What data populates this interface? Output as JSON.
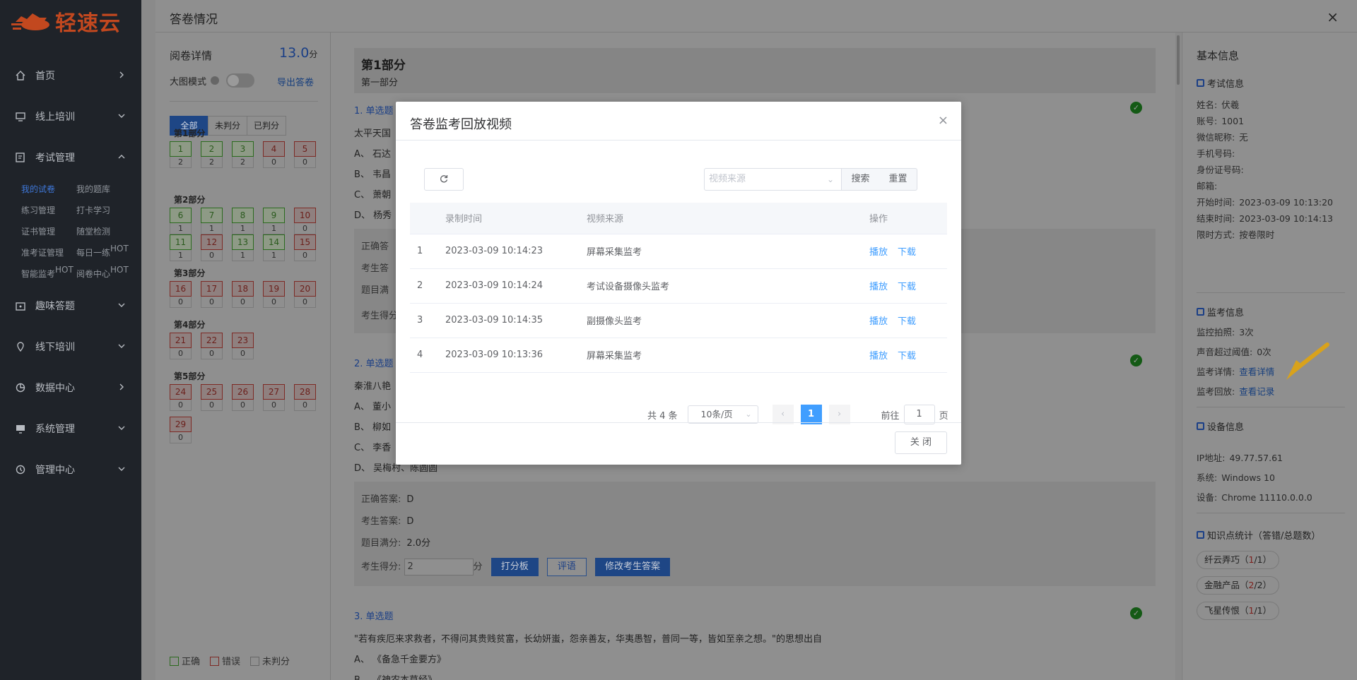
{
  "app": {
    "brand": "轻速云"
  },
  "sidebar": {
    "items": [
      {
        "label": "首页",
        "icon": "home-icon"
      },
      {
        "label": "线上培训",
        "icon": "monitor-icon"
      },
      {
        "label": "考试管理",
        "icon": "exam-icon"
      },
      {
        "label": "趣味答题",
        "icon": "quiz-icon"
      },
      {
        "label": "线下培训",
        "icon": "location-icon"
      },
      {
        "label": "数据中心",
        "icon": "chart-icon"
      },
      {
        "label": "系统管理",
        "icon": "desktop-icon"
      },
      {
        "label": "管理中心",
        "icon": "history-icon"
      }
    ],
    "sub": [
      "我的试卷",
      "我的题库",
      "练习管理",
      "打卡学习",
      "证书管理",
      "随堂检测",
      "准考证管理",
      "每日一练",
      "智能监考",
      "阅卷中心"
    ],
    "hot": "HOT"
  },
  "topbar": {
    "title": "答卷情况",
    "close": "×"
  },
  "left": {
    "title": "阅卷详情",
    "score": "13.0",
    "score_unit": "分",
    "big_mode": "大图模式",
    "export": "导出答卷",
    "filters": [
      "全部",
      "未判分",
      "已判分"
    ],
    "parts": [
      {
        "name": "第1部分",
        "q": [
          [
            "1",
            "2",
            "g"
          ],
          [
            "2",
            "2",
            "g"
          ],
          [
            "3",
            "2",
            "g"
          ],
          [
            "4",
            "0",
            "r"
          ],
          [
            "5",
            "0",
            "r"
          ]
        ]
      },
      {
        "name": "第2部分",
        "q": [
          [
            "6",
            "1",
            "g"
          ],
          [
            "7",
            "1",
            "g"
          ],
          [
            "8",
            "1",
            "g"
          ],
          [
            "9",
            "1",
            "g"
          ],
          [
            "10",
            "0",
            "r"
          ]
        ]
      },
      {
        "name": "",
        "q": [
          [
            "11",
            "1",
            "g"
          ],
          [
            "12",
            "0",
            "r"
          ],
          [
            "13",
            "1",
            "g"
          ],
          [
            "14",
            "1",
            "g"
          ],
          [
            "15",
            "0",
            "r"
          ]
        ]
      },
      {
        "name": "第3部分",
        "q": [
          [
            "16",
            "0",
            "r"
          ],
          [
            "17",
            "0",
            "r"
          ],
          [
            "18",
            "0",
            "r"
          ],
          [
            "19",
            "0",
            "r"
          ],
          [
            "20",
            "0",
            "r"
          ]
        ]
      },
      {
        "name": "第4部分",
        "q": [
          [
            "21",
            "0",
            "r"
          ],
          [
            "22",
            "0",
            "r"
          ],
          [
            "23",
            "0",
            "r"
          ]
        ]
      },
      {
        "name": "第5部分",
        "q": [
          [
            "24",
            "0",
            "r"
          ],
          [
            "25",
            "0",
            "r"
          ],
          [
            "26",
            "0",
            "r"
          ],
          [
            "27",
            "0",
            "r"
          ],
          [
            "28",
            "0",
            "r"
          ]
        ]
      },
      {
        "name": "",
        "q": [
          [
            "29",
            "0",
            "r"
          ]
        ]
      }
    ],
    "legend": [
      "正确",
      "错误",
      "未判分"
    ]
  },
  "content": {
    "section_title": "第1部分",
    "section_sub": "第一部分",
    "q1": {
      "type": "1. 单选题",
      "text": "太平天国",
      "opts": [
        "A、 石达",
        "B、 韦昌",
        "C、 萧朝",
        "D、 杨秀"
      ],
      "rows": [
        "正确答",
        "考生答",
        "题目满",
        "考生得分"
      ]
    },
    "q2": {
      "type": "2. 单选题",
      "text": "秦淮八艳",
      "opts": [
        "A、 董小",
        "B、 柳如",
        "C、 李香",
        "D、 吴梅村、陈圆圆"
      ],
      "correct_label": "正确答案:",
      "correct": "D",
      "student_label": "考生答案:",
      "student": "D",
      "full_label": "题目满分:",
      "full": "2.0分",
      "got_label": "考生得分:",
      "got": "2",
      "got_unit": "分",
      "btn_board": "打分板",
      "btn_comment": "评语",
      "btn_modify": "修改考生答案"
    },
    "q3": {
      "type": "3. 单选题",
      "text": "\"若有疾厄来求救者，不得问其贵贱贫富，长幼妍蚩，怨亲善友，华夷愚智，普同一等，皆如至亲之想。\"的思想出自",
      "opts": [
        "A、 《备急千金要方》",
        "B、 《神农本草经》"
      ]
    }
  },
  "right": {
    "title": "基本信息",
    "exam_info": "考试信息",
    "fields": [
      [
        "姓名:",
        "伏羲"
      ],
      [
        "账号:",
        "1001"
      ],
      [
        "微信昵称:",
        "无"
      ],
      [
        "手机号码:",
        ""
      ],
      [
        "身份证号码:",
        ""
      ],
      [
        "邮箱:",
        ""
      ],
      [
        "开始时间:",
        "2023-03-09 10:13:20"
      ],
      [
        "结束时间:",
        "2023-03-09 10:14:13"
      ],
      [
        "限时方式:",
        "按卷限时"
      ]
    ],
    "monitor_info": "监考信息",
    "monitor": [
      [
        "监控拍照:",
        "3次"
      ],
      [
        "声音超过阈值:",
        "0次"
      ]
    ],
    "detail_label": "监考详情:",
    "detail_link": "查看详情",
    "replay_label": "监考回放:",
    "replay_link": "查看记录",
    "device_info": "设备信息",
    "device": [
      [
        "IP地址:",
        "49.77.57.61"
      ],
      [
        "系统:",
        "Windows 10"
      ],
      [
        "设备:",
        "Chrome 11110.0.0.0"
      ]
    ],
    "knowledge_title": "知识点统计（答错/总题数）",
    "tags": [
      [
        "纤云弄巧（",
        "1",
        "/1）"
      ],
      [
        "金融产品（",
        "2",
        "/2）"
      ],
      [
        "飞星传恨（",
        "1",
        "/1）"
      ]
    ]
  },
  "modal": {
    "title": "答卷监考回放视频",
    "close": "×",
    "select_placeholder": "视频来源",
    "search": "搜索",
    "reset": "重置",
    "headers": [
      "",
      "录制时间",
      "视频来源",
      "操作"
    ],
    "rows": [
      [
        "1",
        "2023-03-09 10:14:23",
        "屏幕采集监考"
      ],
      [
        "2",
        "2023-03-09 10:14:24",
        "考试设备摄像头监考"
      ],
      [
        "3",
        "2023-03-09 10:14:35",
        "副摄像头监考"
      ],
      [
        "4",
        "2023-03-09 10:13:36",
        "屏幕采集监考"
      ]
    ],
    "play": "播放",
    "download": "下载",
    "total": "共 4 条",
    "page_size": "10条/页",
    "current_page": "1",
    "goto": "前往",
    "goto_value": "1",
    "page_unit": "页",
    "close_btn": "关 闭"
  }
}
